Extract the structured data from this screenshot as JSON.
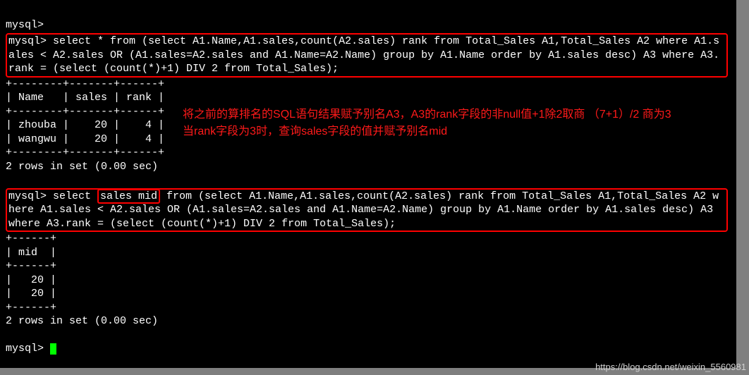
{
  "prompt_empty": "mysql>",
  "query1": {
    "prompt": "mysql> ",
    "sql": "select * from (select A1.Name,A1.sales,count(A2.sales) rank from Total_Sales A1,Total_Sales A2 where A1.sales < A2.sales OR (A1.sales=A2.sales and A1.Name=A2.Name) group by A1.Name order by A1.sales desc) A3 where A3.rank = (select (count(*)+1) DIV 2 from Total_Sales);"
  },
  "result1": {
    "divider": "+--------+-------+------+",
    "header": "| Name   | sales | rank |",
    "rows": [
      "| zhouba |    20 |    4 |",
      "| wangwu |    20 |    4 |"
    ],
    "footer": "2 rows in set (0.00 sec)"
  },
  "annotation": "将之前的算排名的SQL语句结果赋予别名A3，A3的rank字段的非null值+1除2取商 （7+1）/2 商为3 当rank字段为3时，查询sales字段的值并赋予别名mid",
  "query2": {
    "prompt": "mysql> ",
    "pre": "select ",
    "highlight": "sales mid",
    "post": " from (select A1.Name,A1.sales,count(A2.sales) rank from Total_Sales A1,Total_Sales A2 where A1.sales < A2.sales OR (A1.sales=A2.sales and A1.Name=A2.Name) group by A1.Name order by A1.sales desc) A3 where A3.rank = (select (count(*)+1) DIV 2 from Total_Sales);"
  },
  "result2": {
    "divider": "+------+",
    "header": "| mid  |",
    "rows": [
      "|   20 |",
      "|   20 |"
    ],
    "footer": "2 rows in set (0.00 sec)"
  },
  "watermark": "https://blog.csdn.net/weixin_5560981"
}
